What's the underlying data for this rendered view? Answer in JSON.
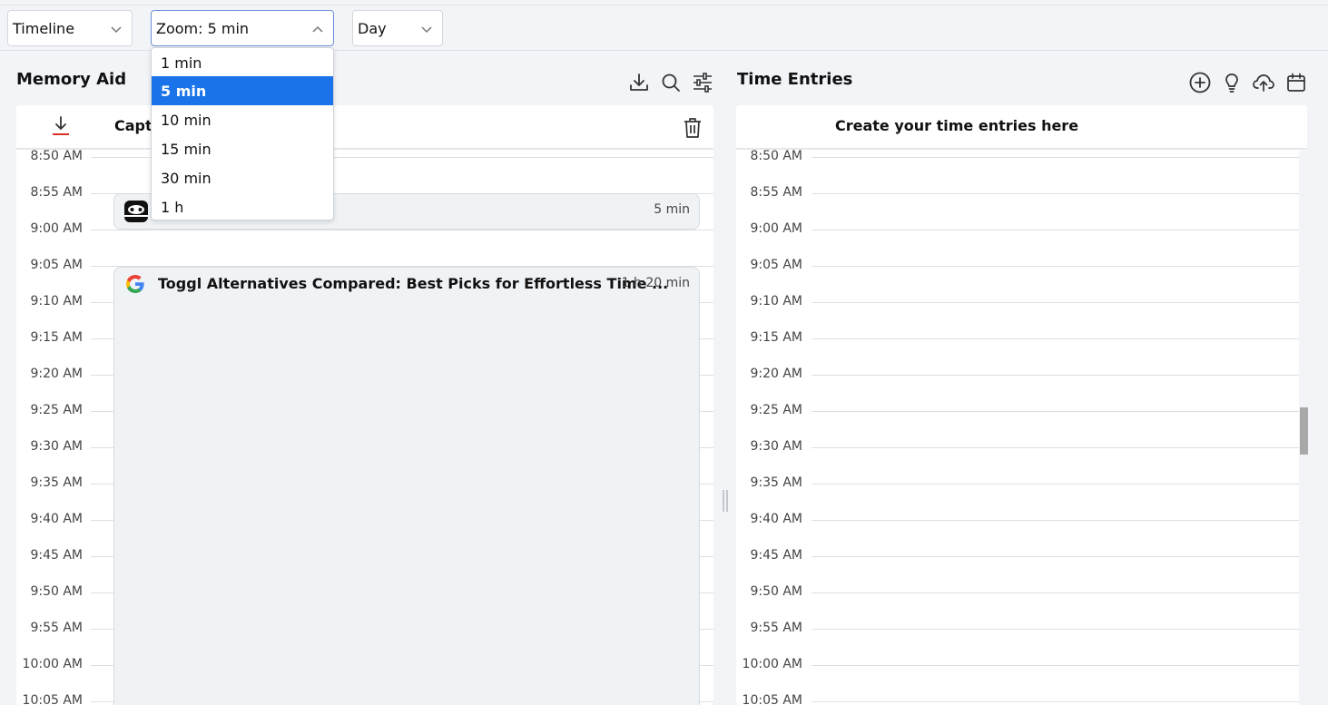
{
  "toolbar": {
    "view_select": "Timeline",
    "zoom_select": "Zoom: 5 min",
    "range_select": "Day"
  },
  "zoom_menu": {
    "options": [
      "1 min",
      "5 min",
      "10 min",
      "15 min",
      "30 min",
      "1 h"
    ],
    "selected": "5 min"
  },
  "memory_aid": {
    "title": "Memory Aid",
    "header_label": "Capt",
    "times": [
      "8:50 AM",
      "8:55 AM",
      "9:00 AM",
      "9:05 AM",
      "9:10 AM",
      "9:15 AM",
      "9:20 AM",
      "9:25 AM",
      "9:30 AM",
      "9:35 AM",
      "9:40 AM",
      "9:45 AM",
      "9:50 AM",
      "9:55 AM",
      "10:00 AM",
      "10:05 AM"
    ],
    "events": [
      {
        "title": "",
        "duration": "5 min",
        "icon": "sloth-app-icon"
      },
      {
        "title": "Toggl Alternatives Compared: Best Picks for Effortless Time ...",
        "duration": "1 h 20 min",
        "icon": "google-icon"
      }
    ]
  },
  "time_entries": {
    "title": "Time Entries",
    "header_label": "Create your time entries here",
    "times": [
      "8:50 AM",
      "8:55 AM",
      "9:00 AM",
      "9:05 AM",
      "9:10 AM",
      "9:15 AM",
      "9:20 AM",
      "9:25 AM",
      "9:30 AM",
      "9:35 AM",
      "9:40 AM",
      "9:45 AM",
      "9:50 AM",
      "9:55 AM",
      "10:00 AM",
      "10:05 AM"
    ]
  },
  "colors": {
    "accent": "#1a73e8",
    "download_accent": "#d93025"
  }
}
